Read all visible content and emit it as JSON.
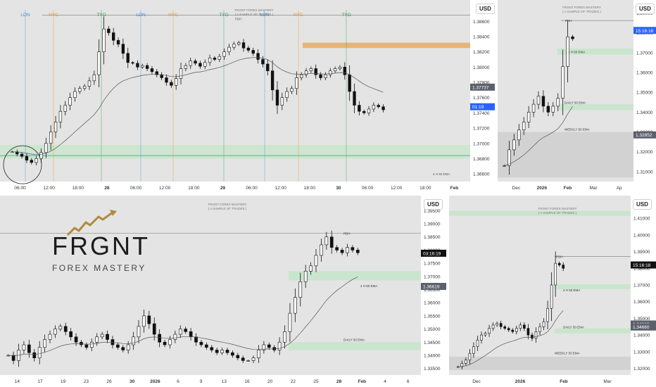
{
  "currency": "USD",
  "brand": {
    "main": "FRGNT",
    "sub": "FOREX MASTERY"
  },
  "watermark": {
    "line1": "FRGNT FOREX MASTERY",
    "line2": "( A SAMPLE OF TRADES )"
  },
  "colors": {
    "bull": "#ffffff",
    "bear": "#111111",
    "zone": "#bfe6c3",
    "lon": "#3b8fd9",
    "nyc": "#e8962e",
    "tyo": "#3a9a4a",
    "blue_tag": "#2962ff"
  },
  "chart_data": [
    {
      "id": "tl",
      "type": "candlestick",
      "timeframe_labels": [
        "06:00",
        "12:00",
        "18:00",
        "28",
        "06:00",
        "12:00",
        "18:00",
        "29",
        "06:00",
        "12:00",
        "18:00",
        "30",
        "06:00",
        "12:00",
        "18:00",
        "Feb"
      ],
      "session_labels": [
        "LON",
        "NYC",
        "TYO",
        "LON",
        "NYC",
        "TYO",
        "LON",
        "NYC",
        "TYO"
      ],
      "y_ticks": [
        "1.38600",
        "1.38400",
        "1.38200",
        "1.38000",
        "1.37800",
        "1.37600",
        "1.37400",
        "1.37200",
        "1.37000",
        "1.36800",
        "1.36600"
      ],
      "ylim": [
        1.365,
        1.3875
      ],
      "price_tag": "1.37737",
      "timer_tag": "01:19",
      "annotations": [
        "PDH",
        "4 H 50 EMA"
      ],
      "closes": [
        1.3689,
        1.3686,
        1.3683,
        1.3678,
        1.3675,
        1.368,
        1.3688,
        1.37,
        1.3715,
        1.3728,
        1.3742,
        1.375,
        1.376,
        1.3768,
        1.3772,
        1.3775,
        1.3782,
        1.379,
        1.382,
        1.385,
        1.3845,
        1.3835,
        1.383,
        1.3818,
        1.3806,
        1.3805,
        1.38,
        1.3802,
        1.3798,
        1.3794,
        1.379,
        1.3786,
        1.378,
        1.3776,
        1.3785,
        1.3798,
        1.3802,
        1.3808,
        1.3805,
        1.3801,
        1.3806,
        1.3812,
        1.381,
        1.3814,
        1.382,
        1.3826,
        1.383,
        1.3832,
        1.3825,
        1.3822,
        1.3818,
        1.381,
        1.3804,
        1.3795,
        1.377,
        1.375,
        1.376,
        1.3768,
        1.3772,
        1.3786,
        1.379,
        1.3795,
        1.3798,
        1.379,
        1.3786,
        1.379,
        1.3795,
        1.3798,
        1.38,
        1.379,
        1.3768,
        1.375,
        1.3742,
        1.374,
        1.3745,
        1.375,
        1.3748,
        1.3744
      ]
    },
    {
      "id": "tr",
      "type": "candlestick",
      "x_labels": [
        "Dec",
        "2026",
        "Feb",
        "Mar",
        "Ap"
      ],
      "y_ticks": [
        "1.39000",
        "1.38000",
        "1.37000",
        "1.36000",
        "1.35000",
        "1.34000",
        "1.33000",
        "1.32000",
        "1.31000"
      ],
      "ylim": [
        1.305,
        1.393
      ],
      "price_tag": "15:16:18",
      "price_tag2": "1.32852",
      "annotations": [
        "PDH",
        "4 H 50 EMA",
        "DAILY 50 EMA",
        "WEEKLY 50 EMA"
      ],
      "closes": [
        1.313,
        1.321,
        1.326,
        1.331,
        1.335,
        1.34,
        1.344,
        1.348,
        1.343,
        1.34,
        1.343,
        1.347,
        1.363,
        1.378,
        1.377
      ]
    },
    {
      "id": "bl",
      "type": "candlestick",
      "x_labels": [
        "14",
        "17",
        "19",
        "23",
        "26",
        "30",
        "2026",
        "6",
        "9",
        "13",
        "16",
        "20",
        "22",
        "25",
        "28",
        "Feb",
        "4",
        "6"
      ],
      "y_ticks": [
        "1.39500",
        "1.39000",
        "1.38500",
        "1.38000",
        "1.37500",
        "1.37000",
        "1.36500",
        "1.36000",
        "1.35500",
        "1.35000",
        "1.34500",
        "1.34000",
        "1.33500"
      ],
      "ylim": [
        1.3325,
        1.3975
      ],
      "price_tag": "03:16:19",
      "price_tag2": "1.36619",
      "annotations": [
        "PDH",
        "4 H 50 EMA",
        "DAILY 50 EMA"
      ],
      "closes": [
        1.34,
        1.338,
        1.342,
        1.344,
        1.341,
        1.339,
        1.343,
        1.346,
        1.348,
        1.35,
        1.351,
        1.349,
        1.347,
        1.345,
        1.344,
        1.343,
        1.345,
        1.347,
        1.348,
        1.346,
        1.344,
        1.343,
        1.342,
        1.344,
        1.347,
        1.351,
        1.355,
        1.352,
        1.348,
        1.345,
        1.344,
        1.346,
        1.348,
        1.35,
        1.349,
        1.347,
        1.345,
        1.344,
        1.343,
        1.342,
        1.341,
        1.342,
        1.341,
        1.34,
        1.339,
        1.338,
        1.338,
        1.339,
        1.342,
        1.344,
        1.343,
        1.342,
        1.345,
        1.349,
        1.356,
        1.362,
        1.368,
        1.372,
        1.374,
        1.378,
        1.382,
        1.385,
        1.381,
        1.38,
        1.379,
        1.381,
        1.38,
        1.379
      ]
    },
    {
      "id": "br",
      "type": "candlestick",
      "x_labels": [
        "Dec",
        "2026",
        "Feb",
        "Mar"
      ],
      "y_ticks": [
        "1.41000",
        "1.40000",
        "1.39000",
        "1.38000",
        "1.37000",
        "1.36000",
        "1.35000",
        "1.34000",
        "1.33000",
        "1.32000"
      ],
      "ylim": [
        1.316,
        1.416
      ],
      "price_tag": "15:16:18",
      "price_tag2": "1.34660",
      "price_tag3": "1.34660",
      "annotations": [
        "PDH",
        "4 H 50 EMA",
        "DAILY 50 EMA",
        "WEEKLY 50 EMA"
      ],
      "closes": [
        1.321,
        1.323,
        1.325,
        1.329,
        1.333,
        1.337,
        1.34,
        1.341,
        1.344,
        1.346,
        1.347,
        1.345,
        1.344,
        1.343,
        1.342,
        1.344,
        1.346,
        1.344,
        1.34,
        1.338,
        1.342,
        1.345,
        1.348,
        1.356,
        1.37,
        1.383,
        1.382,
        1.38
      ]
    }
  ]
}
